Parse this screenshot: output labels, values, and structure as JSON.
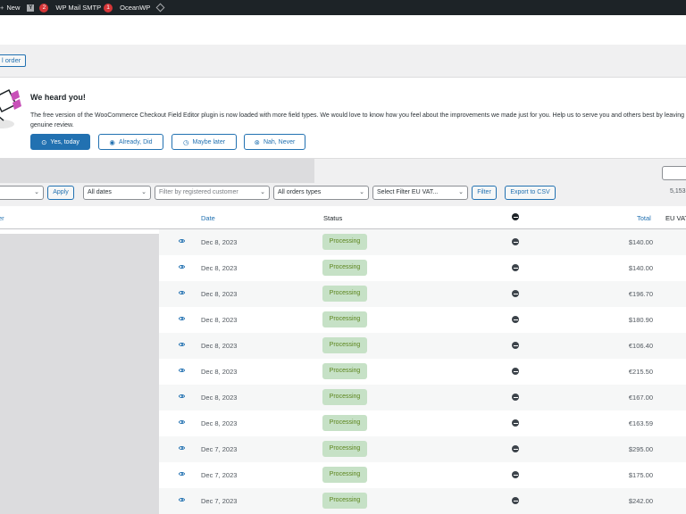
{
  "admin_bar": {
    "new_label": "New",
    "yoast_count": "2",
    "smtp_label": "WP Mail SMTP",
    "smtp_count": "1",
    "oceanwp_label": "OceanWP"
  },
  "page": {
    "add_order_label": "l order"
  },
  "notice": {
    "title": "We heard you!",
    "text": "The free version of the WooCommerce Checkout Field Editor plugin is now loaded with more field types. We would love to know how you feel about the improvements we made just for you. Help us to serve you and others best by leaving a genuine review.",
    "buttons": {
      "yes": "Yes, today",
      "already": "Already, Did",
      "maybe": "Maybe later",
      "never": "Nah, Never"
    }
  },
  "filters": {
    "bulk_action": "",
    "apply": "Apply",
    "dates": "All dates",
    "customer_placeholder": "Filter by registered customer",
    "order_types": "All orders types",
    "eu_vat": "Select Filter EU VAT...",
    "filter": "Filter",
    "export": "Export to CSV",
    "items_count": "5,153"
  },
  "table": {
    "headers": {
      "order": "er",
      "date": "Date",
      "status": "Status",
      "total": "Total",
      "eu_vat": "EU VAT"
    },
    "rows": [
      {
        "date": "Dec 8, 2023",
        "status": "Processing",
        "total": "$140.00"
      },
      {
        "date": "Dec 8, 2023",
        "status": "Processing",
        "total": "$140.00"
      },
      {
        "date": "Dec 8, 2023",
        "status": "Processing",
        "total": "€196.70"
      },
      {
        "date": "Dec 8, 2023",
        "status": "Processing",
        "total": "$180.90"
      },
      {
        "date": "Dec 8, 2023",
        "status": "Processing",
        "total": "€106.40"
      },
      {
        "date": "Dec 8, 2023",
        "status": "Processing",
        "total": "€215.50"
      },
      {
        "date": "Dec 8, 2023",
        "status": "Processing",
        "total": "€167.00"
      },
      {
        "date": "Dec 8, 2023",
        "status": "Processing",
        "total": "€163.59"
      },
      {
        "date": "Dec 7, 2023",
        "status": "Processing",
        "total": "$295.00"
      },
      {
        "date": "Dec 7, 2023",
        "status": "Processing",
        "total": "$175.00"
      },
      {
        "date": "Dec 7, 2023",
        "status": "Processing",
        "total": "$242.00"
      }
    ]
  },
  "colors": {
    "admin_bar": "#1d2327",
    "accent": "#2271b1",
    "processing_bg": "#c6e1c6",
    "processing_text": "#5b841b",
    "badge": "#d63638"
  },
  "icons": {
    "admin_bar_new": "plus-icon",
    "yoast": "yoast-icon",
    "oceanwp": "diamond-icon",
    "row_preview": "eye-icon",
    "origin_column": "globe-icon"
  }
}
